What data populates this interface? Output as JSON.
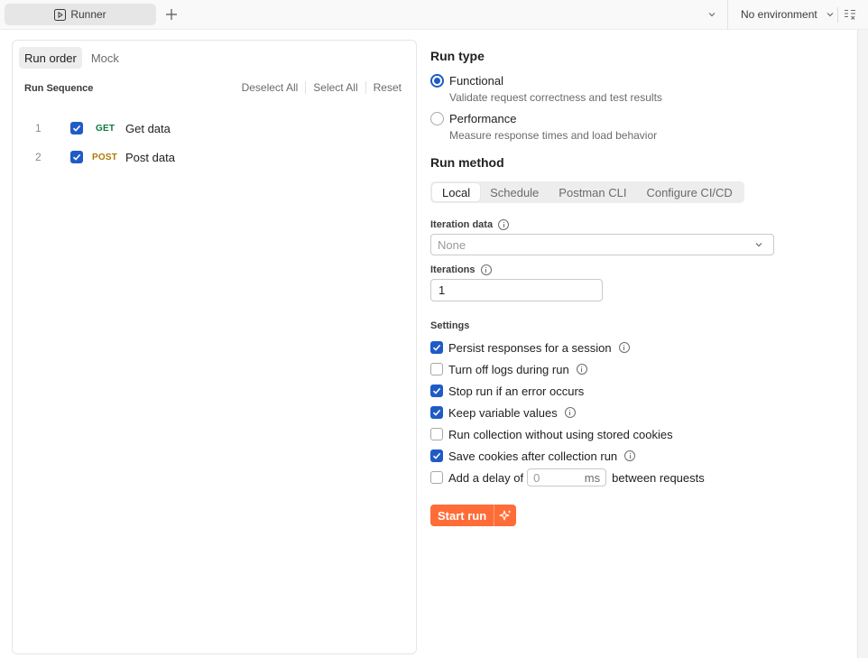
{
  "topbar": {
    "tab_label": "Runner",
    "new_tab_label": "+",
    "environment": "No environment"
  },
  "left_panel": {
    "tabs": [
      {
        "label": "Run order",
        "active": true
      },
      {
        "label": "Mock",
        "active": false
      }
    ],
    "sequence_title": "Run Sequence",
    "actions": {
      "deselect_all": "Deselect All",
      "select_all": "Select All",
      "reset": "Reset"
    },
    "requests": [
      {
        "index": "1",
        "checked": true,
        "method": "GET",
        "method_color": "#0b7a3e",
        "name": "Get data"
      },
      {
        "index": "2",
        "checked": true,
        "method": "POST",
        "method_color": "#ad7a03",
        "name": "Post data"
      }
    ]
  },
  "run_type": {
    "title": "Run type",
    "options": [
      {
        "label": "Functional",
        "description": "Validate request correctness and test results",
        "selected": true
      },
      {
        "label": "Performance",
        "description": "Measure response times and load behavior",
        "selected": false
      }
    ]
  },
  "run_method": {
    "title": "Run method",
    "tabs": [
      {
        "label": "Local",
        "active": true
      },
      {
        "label": "Schedule",
        "active": false
      },
      {
        "label": "Postman CLI",
        "active": false
      },
      {
        "label": "Configure CI/CD",
        "active": false
      }
    ]
  },
  "iteration_data": {
    "label": "Iteration data",
    "placeholder": "None"
  },
  "iterations": {
    "label": "Iterations",
    "value": "1"
  },
  "settings": {
    "title": "Settings",
    "items": [
      {
        "label": "Persist responses for a session",
        "checked": true,
        "info": true
      },
      {
        "label": "Turn off logs during run",
        "checked": false,
        "info": true
      },
      {
        "label": "Stop run if an error occurs",
        "checked": true,
        "info": false
      },
      {
        "label": "Keep variable values",
        "checked": true,
        "info": true
      },
      {
        "label": "Run collection without using stored cookies",
        "checked": false,
        "info": false
      },
      {
        "label": "Save cookies after collection run",
        "checked": true,
        "info": true
      }
    ],
    "delay": {
      "label_before": "Add a delay of",
      "value": "0",
      "unit": "ms",
      "label_after": "between requests",
      "checked": false
    }
  },
  "start_button": {
    "label": "Start run"
  },
  "colors": {
    "accent": "#1f5bc6",
    "primary_button": "#ff6c37"
  }
}
